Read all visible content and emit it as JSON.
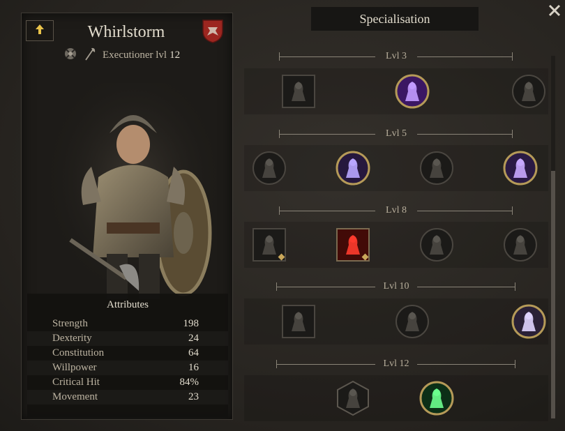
{
  "character": {
    "name": "Whirlstorm",
    "class_name": "Executioner lvl",
    "level": "12",
    "upgrade_icon": "up-arrow-icon",
    "crest_icon": "heraldic-shield-icon"
  },
  "attributes": {
    "title": "Attributes",
    "rows": [
      {
        "label": "Strength",
        "value": "198"
      },
      {
        "label": "Dexterity",
        "value": "24"
      },
      {
        "label": "Constitution",
        "value": "64"
      },
      {
        "label": "Willpower",
        "value": "16"
      },
      {
        "label": "Critical Hit",
        "value": "84%"
      },
      {
        "label": "Movement",
        "value": "23"
      }
    ]
  },
  "specialisation": {
    "title": "Specialisation",
    "close_icon": "close-icon",
    "tiers": [
      {
        "label": "Lvl 3",
        "skills": [
          {
            "name": "shield-silhouette",
            "state": "locked",
            "shape": "square"
          },
          {
            "name": "purple-lightning",
            "state": "selected",
            "shape": "circle"
          },
          {
            "name": "crossed-weapons",
            "state": "locked",
            "shape": "circle"
          }
        ]
      },
      {
        "label": "Lvl 5",
        "skills": [
          {
            "name": "beast-roar",
            "state": "locked",
            "shape": "circle"
          },
          {
            "name": "storm-warrior",
            "state": "selected",
            "shape": "circle"
          },
          {
            "name": "radiant-head",
            "state": "locked",
            "shape": "circle"
          },
          {
            "name": "lightning-axe",
            "state": "selected",
            "shape": "circle"
          }
        ]
      },
      {
        "label": "Lvl 8",
        "skills": [
          {
            "name": "axe-strike",
            "state": "locked",
            "shape": "square"
          },
          {
            "name": "blood-pillar",
            "state": "selected",
            "shape": "square"
          },
          {
            "name": "shadow-aura",
            "state": "locked",
            "shape": "circle"
          },
          {
            "name": "berserker",
            "state": "locked",
            "shape": "circle"
          }
        ]
      },
      {
        "label": "Lvl 10",
        "skills": [
          {
            "name": "cleave",
            "state": "locked",
            "shape": "square"
          },
          {
            "name": "hooded-figure",
            "state": "locked",
            "shape": "circle"
          },
          {
            "name": "wolf-spirit",
            "state": "selected",
            "shape": "circle"
          }
        ]
      },
      {
        "label": "Lvl 12",
        "skills": [
          {
            "name": "hexagon-warrior",
            "state": "locked",
            "shape": "hexagon"
          },
          {
            "name": "green-rune",
            "state": "selected",
            "shape": "circle"
          }
        ]
      }
    ]
  },
  "colors": {
    "background": "#2a2724",
    "panel": "#1d1b18",
    "gold_ring": "#b59a58",
    "accent_purple": "#8a5cc9",
    "accent_red": "#c2251f",
    "accent_green": "#3ab85a"
  }
}
